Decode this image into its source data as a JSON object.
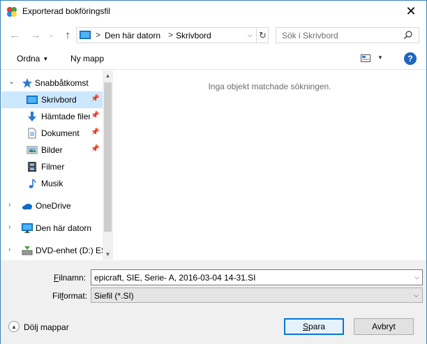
{
  "window": {
    "title": "Exporterad bokföringsfil",
    "close_glyph": "✕"
  },
  "nav": {
    "back_glyph": "←",
    "forward_glyph": "→",
    "recent_glyph": "⌄",
    "up_glyph": "↑"
  },
  "address": {
    "segments": [
      "Den här datorn",
      "Skrivbord"
    ],
    "separator": ">"
  },
  "search": {
    "placeholder": "Sök i Skrivbord"
  },
  "toolbar": {
    "organize_label": "Ordna",
    "new_folder_label": "Ny mapp",
    "help_glyph": "?"
  },
  "nav_pane": {
    "items": [
      {
        "label": "Snabbåtkomst",
        "icon": "star-icon",
        "expander": "⌄",
        "pinned": false
      },
      {
        "label": "Skrivbord",
        "icon": "desktop-icon",
        "pinned": true,
        "selected": true
      },
      {
        "label": "Hämtade filer",
        "icon": "download-icon",
        "pinned": true
      },
      {
        "label": "Dokument",
        "icon": "document-icon",
        "pinned": true
      },
      {
        "label": "Bilder",
        "icon": "pictures-icon",
        "pinned": true
      },
      {
        "label": "Filmer",
        "icon": "film-icon",
        "pinned": false
      },
      {
        "label": "Musik",
        "icon": "music-icon",
        "pinned": false
      },
      {
        "label": "OneDrive",
        "icon": "onedrive-icon",
        "expander": "›"
      },
      {
        "label": "Den här datorn",
        "icon": "computer-icon",
        "expander": "›"
      },
      {
        "label": "DVD-enhet (D:) ES",
        "icon": "dvd-drive-icon",
        "expander": "›"
      }
    ]
  },
  "content": {
    "empty_message": "Inga objekt matchade sökningen."
  },
  "form": {
    "filename_label_pre": "",
    "filename_label_u": "F",
    "filename_label_post": "ilnamn:",
    "filename_value": "epicraft, SIE, Serie- A, 2016-03-04 14-31.SI",
    "format_label_pre": "Fil",
    "format_label_u": "f",
    "format_label_post": "ormat:",
    "format_value": "Siefil (*.SI)",
    "hide_folders_label": "Dölj mappar",
    "save_label_u": "S",
    "save_label_post": "para",
    "cancel_label": "Avbryt"
  },
  "colors": {
    "selection": "#cce8ff",
    "accent": "#0078d7",
    "help": "#1f66c1"
  }
}
